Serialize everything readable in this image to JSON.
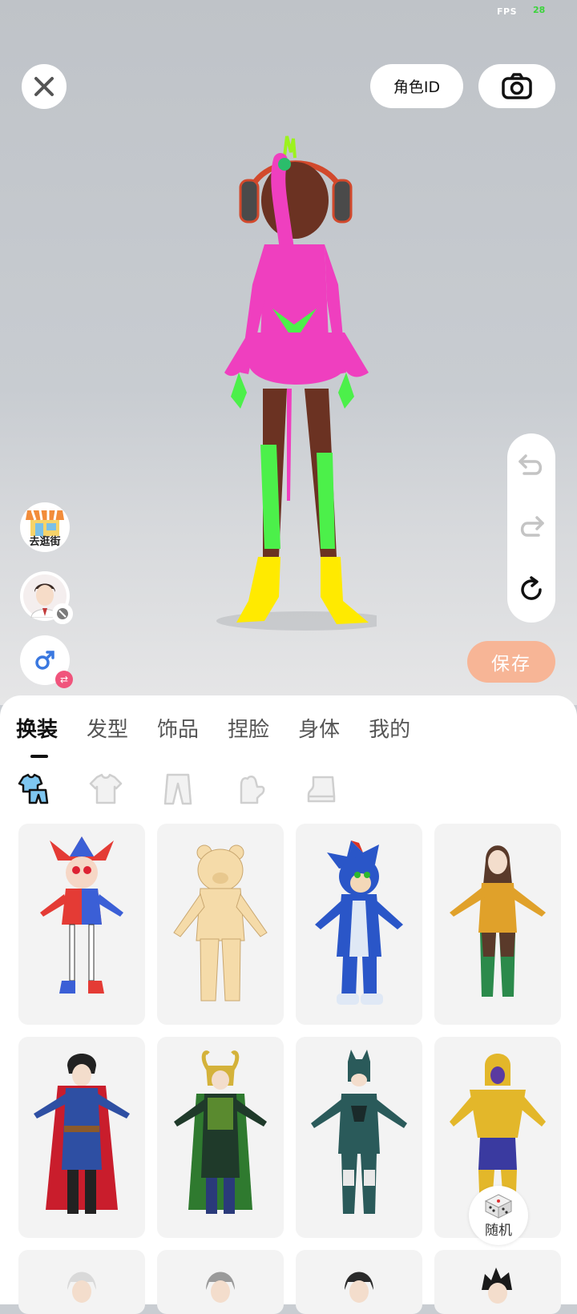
{
  "status": {
    "fps_label": "FPS",
    "fps_value": "28"
  },
  "header": {
    "role_id_label": "角色ID"
  },
  "side_actions": {
    "save_label": "保存"
  },
  "left_actions": {
    "shop_label": "去逛街"
  },
  "tabs": [
    {
      "label": "换装",
      "active": true
    },
    {
      "label": "发型",
      "active": false
    },
    {
      "label": "饰品",
      "active": false
    },
    {
      "label": "捏脸",
      "active": false
    },
    {
      "label": "身体",
      "active": false
    },
    {
      "label": "我的",
      "active": false
    }
  ],
  "subcategories": [
    "full-outfit-icon",
    "top-icon",
    "pants-icon",
    "gloves-icon",
    "shoes-icon"
  ],
  "random_label": "随机",
  "colors": {
    "accent": "#f7b596",
    "badge": "#f0547c"
  }
}
